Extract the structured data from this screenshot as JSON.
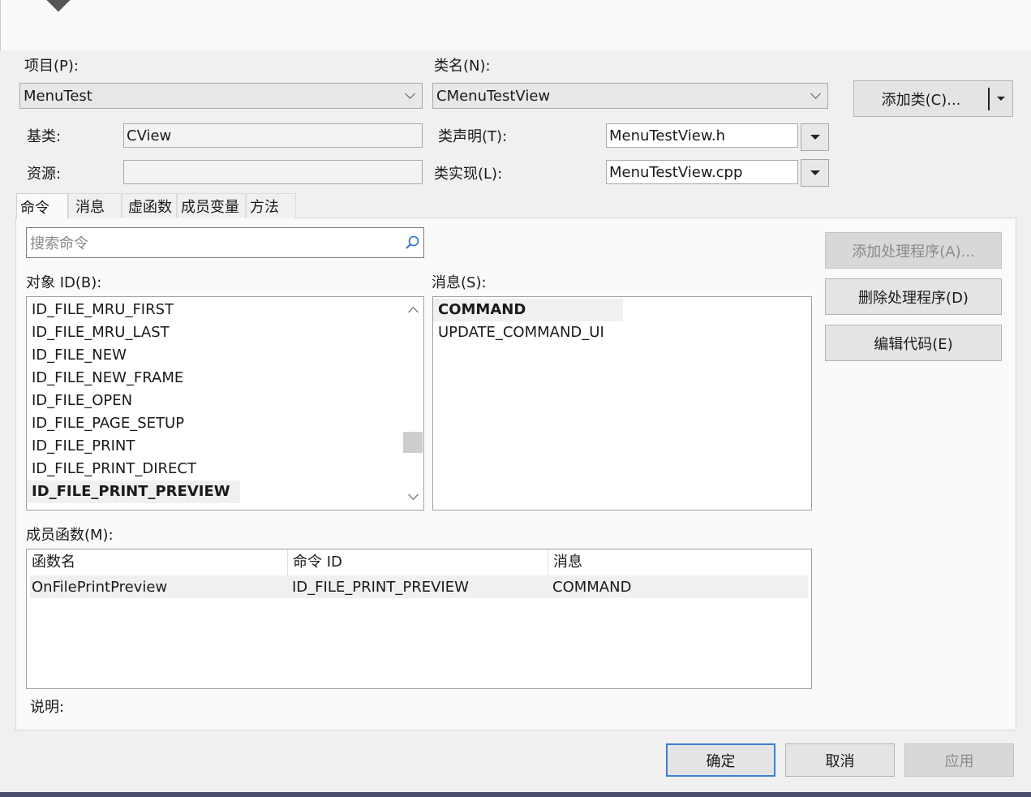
{
  "labels": {
    "project": "项目(P):",
    "class_name": "类名(N):",
    "base_class": "基类:",
    "resource": "资源:",
    "class_decl": "类声明(T):",
    "class_impl": "类实现(L):",
    "object_id": "对象 ID(B):",
    "messages": "消息(S):",
    "member_functions": "成员函数(M):",
    "description": "说明:"
  },
  "fields": {
    "project": "MenuTest",
    "class_name": "CMenuTestView",
    "base_class": "CView",
    "resource": "",
    "class_decl": "MenuTestView.h",
    "class_impl": "MenuTestView.cpp"
  },
  "buttons": {
    "add_class": "添加类(C)...",
    "add_handler": "添加处理程序(A)...",
    "delete_handler": "删除处理程序(D)",
    "edit_code": "编辑代码(E)",
    "ok": "确定",
    "cancel": "取消",
    "apply": "应用"
  },
  "tabs": [
    "命令",
    "消息",
    "虚函数",
    "成员变量",
    "方法"
  ],
  "search": {
    "placeholder": "搜索命令"
  },
  "object_ids": [
    "ID_FILE_MRU_FIRST",
    "ID_FILE_MRU_LAST",
    "ID_FILE_NEW",
    "ID_FILE_NEW_FRAME",
    "ID_FILE_OPEN",
    "ID_FILE_PAGE_SETUP",
    "ID_FILE_PRINT",
    "ID_FILE_PRINT_DIRECT",
    "ID_FILE_PRINT_PREVIEW"
  ],
  "selected_object_id": "ID_FILE_PRINT_PREVIEW",
  "message_list": [
    "COMMAND",
    "UPDATE_COMMAND_UI"
  ],
  "member_table": {
    "columns": [
      "函数名",
      "命令 ID",
      "消息"
    ],
    "rows": [
      [
        "OnFilePrintPreview",
        "ID_FILE_PRINT_PREVIEW",
        "COMMAND"
      ]
    ]
  }
}
